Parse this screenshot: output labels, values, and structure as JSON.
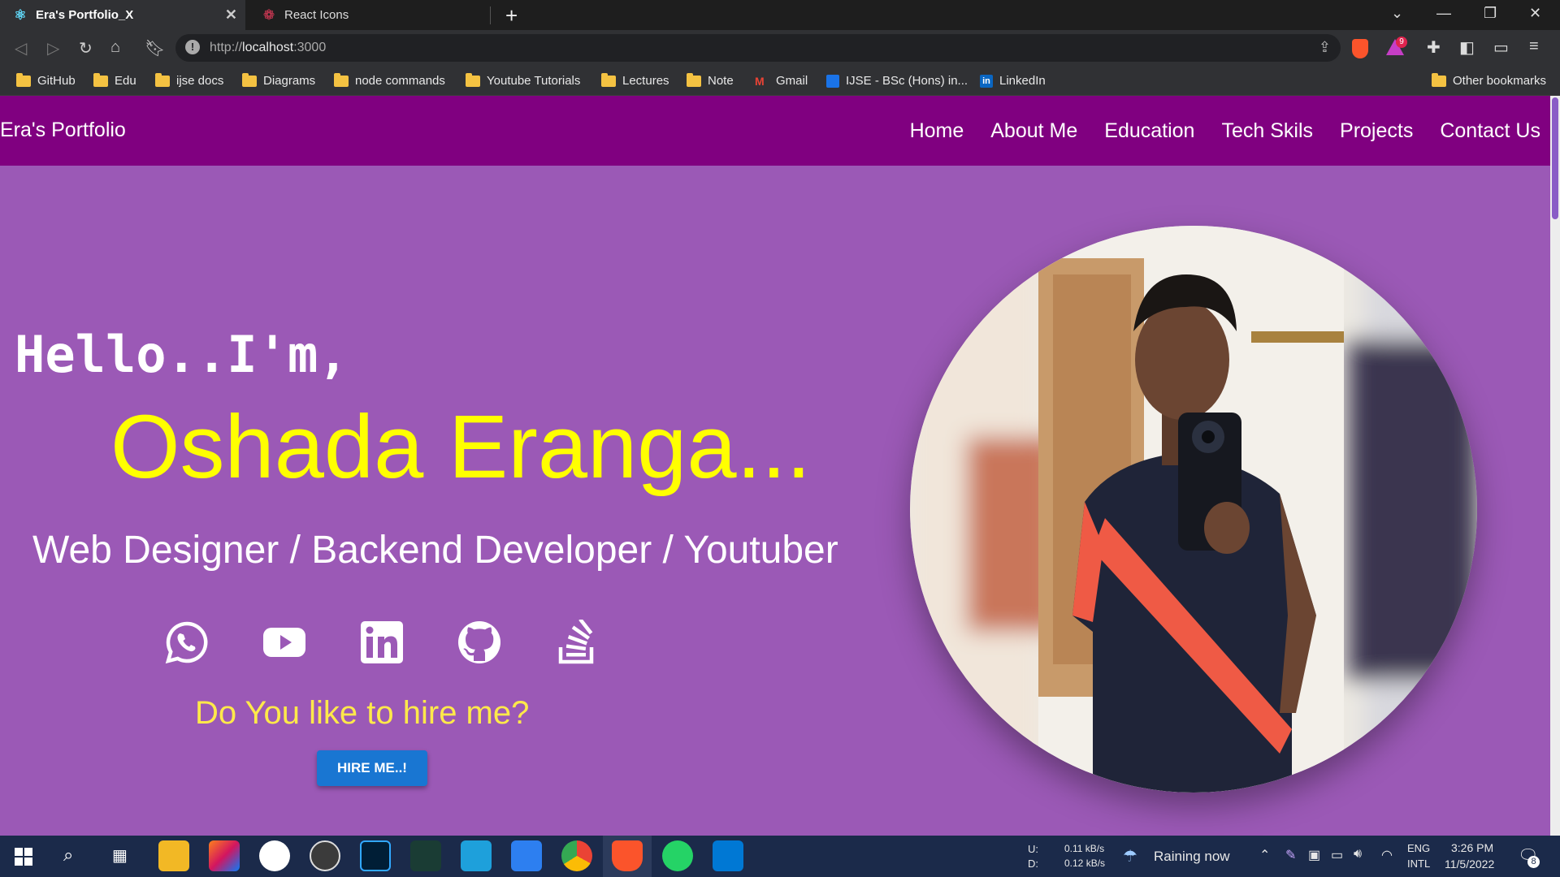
{
  "browser": {
    "tabs": [
      {
        "title": "Era's Portfolio_X",
        "active": true
      },
      {
        "title": "React Icons",
        "active": false
      }
    ],
    "url": {
      "scheme": "http://",
      "host": "localhost",
      "port": ":3000"
    },
    "rewards_count": "9",
    "bookmarks": [
      {
        "label": "GitHub",
        "icon": "folder-icon"
      },
      {
        "label": "Edu",
        "icon": "folder-icon"
      },
      {
        "label": "ijse docs",
        "icon": "folder-icon"
      },
      {
        "label": "Diagrams",
        "icon": "folder-icon"
      },
      {
        "label": "node commands",
        "icon": "folder-icon"
      },
      {
        "label": "Youtube Tutorials",
        "icon": "folder-icon"
      },
      {
        "label": "Lectures",
        "icon": "folder-icon"
      },
      {
        "label": "Note",
        "icon": "folder-icon"
      },
      {
        "label": "Gmail",
        "icon": "gmail-icon"
      },
      {
        "label": "IJSE - BSc (Hons) in...",
        "icon": "ijse-icon"
      },
      {
        "label": "LinkedIn",
        "icon": "linkedin-icon"
      }
    ],
    "other_bookmarks": "Other bookmarks"
  },
  "site": {
    "brand": "Era's Portfolio",
    "nav": [
      "Home",
      "About Me",
      "Education",
      "Tech Skils",
      "Projects",
      "Contact Us"
    ],
    "hero": {
      "greeting": "Hello..I'm,",
      "name": "Oshada Eranga...",
      "role": "Web Designer / Backend Developer / Youtuber",
      "socials": [
        "whatsapp-icon",
        "youtube-icon",
        "linkedin-icon",
        "github-icon",
        "stackoverflow-icon"
      ],
      "hire_question": "Do You like to hire me?",
      "hire_button": "HIRE ME..!"
    },
    "colors": {
      "navbar": "#800080",
      "background": "#9b59b6",
      "name": "#ffff00",
      "hire_text": "#ffe94a",
      "button": "#1976d2"
    }
  },
  "taskbar": {
    "network": {
      "up_label": "U:",
      "down_label": "D:",
      "up": "0.11 kB/s",
      "down": "0.12 kB/s"
    },
    "weather": "Raining now",
    "language": {
      "lang": "ENG",
      "layout": "INTL"
    },
    "time": "3:26 PM",
    "date": "11/5/2022",
    "notifications": "8"
  }
}
